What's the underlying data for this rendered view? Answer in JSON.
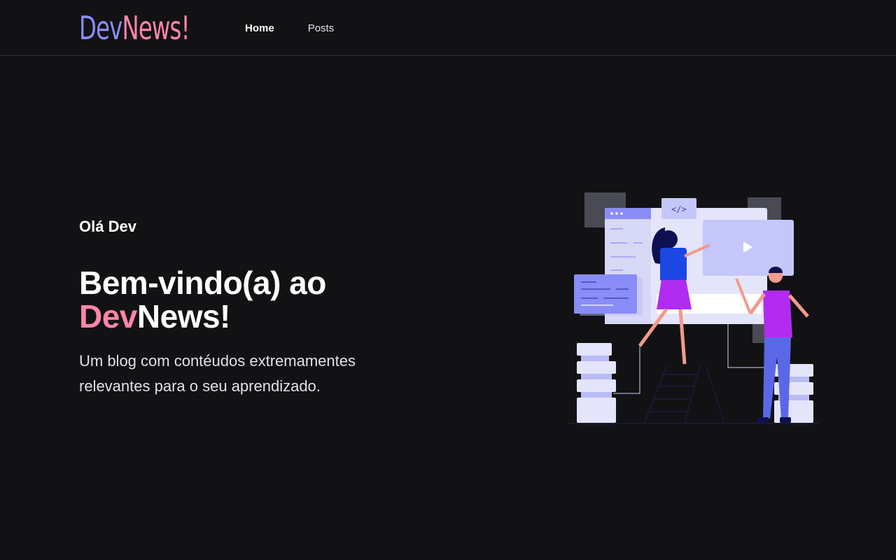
{
  "header": {
    "logo_part1": "Dev",
    "logo_part2": "News!",
    "nav": [
      {
        "label": "Home",
        "active": true
      },
      {
        "label": "Posts",
        "active": false
      }
    ]
  },
  "hero": {
    "greeting": "Olá Dev",
    "title_line1": "Bem-vindo(a) ao",
    "title_highlight": "Dev",
    "title_rest": "News!",
    "subtitle": "Um blog com contéudos extremamentes relevantes para o seu aprendizado.",
    "illustration": "developers-illustration",
    "code_badge": "</>"
  },
  "colors": {
    "background": "#121214",
    "accent_purple": "#8a8df6",
    "accent_pink": "#ff85a8"
  }
}
